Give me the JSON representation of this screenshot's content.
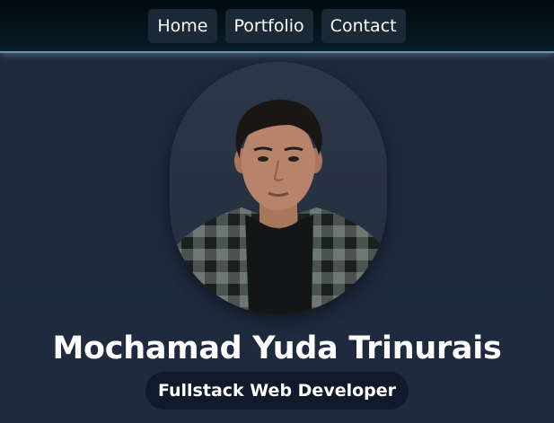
{
  "nav": {
    "items": [
      {
        "label": "Home"
      },
      {
        "label": "Portfolio"
      },
      {
        "label": "Contact"
      }
    ]
  },
  "profile": {
    "photo": "profile-photo",
    "name": "Mochamad Yuda Trinurais",
    "role": "Fullstack Web Developer"
  },
  "colors": {
    "background": "#1e293b",
    "nav_background": "#030c12",
    "nav_border": "#6c8fb4",
    "button": "#1b2836",
    "role_badge": "#111a2a",
    "text": "#ffffff"
  }
}
